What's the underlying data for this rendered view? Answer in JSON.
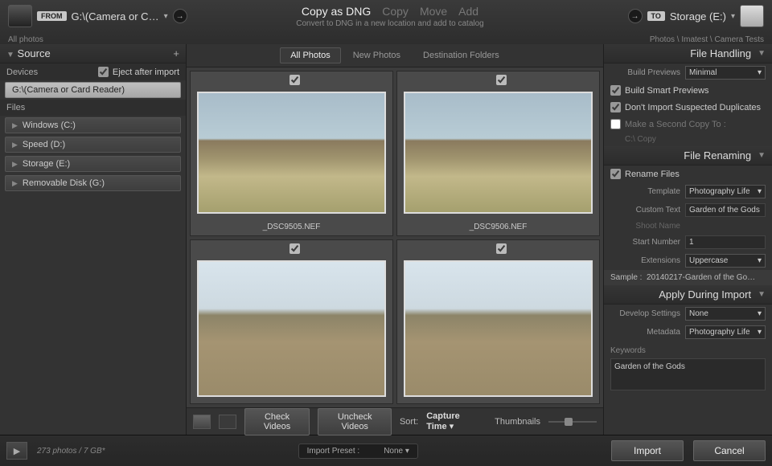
{
  "top": {
    "from_badge": "FROM",
    "from_path": "G:\\(Camera or C…",
    "from_sub": "All photos",
    "actions": {
      "copy_dng": "Copy as DNG",
      "copy": "Copy",
      "move": "Move",
      "add": "Add"
    },
    "subtitle": "Convert to DNG in a new location and add to catalog",
    "to_badge": "TO",
    "to_path": "Storage (E:)",
    "to_sub": "Photos \\ Imatest \\ Camera Tests"
  },
  "source": {
    "title": "Source",
    "devices_label": "Devices",
    "eject_label": "Eject after import",
    "selected_device": "G:\\(Camera or Card Reader)",
    "files_label": "Files",
    "drives": [
      "Windows (C:)",
      "Speed (D:)",
      "Storage (E:)",
      "Removable Disk (G:)"
    ]
  },
  "center": {
    "tabs": {
      "all": "All Photos",
      "new": "New Photos",
      "dest": "Destination Folders"
    },
    "thumbs": [
      "_DSC9505.NEF",
      "_DSC9506.NEF"
    ],
    "toolbar": {
      "check_videos": "Check Videos",
      "uncheck_videos": "Uncheck Videos",
      "sort_label": "Sort:",
      "sort_value": "Capture Time",
      "thumb_label": "Thumbnails"
    }
  },
  "right": {
    "file_handling": {
      "title": "File Handling",
      "build_previews_label": "Build Previews",
      "build_previews_value": "Minimal",
      "smart_previews": "Build Smart Previews",
      "no_dupes": "Don't Import Suspected Duplicates",
      "second_copy": "Make a Second Copy To :",
      "second_copy_path": "C:\\ Copy"
    },
    "file_renaming": {
      "title": "File Renaming",
      "rename_files": "Rename Files",
      "template_label": "Template",
      "template_value": "Photography Life",
      "custom_text_label": "Custom Text",
      "custom_text_value": "Garden of the Gods",
      "shoot_name_label": "Shoot Name",
      "start_number_label": "Start Number",
      "start_number_value": "1",
      "extensions_label": "Extensions",
      "extensions_value": "Uppercase",
      "sample_label": "Sample :",
      "sample_value": "20140217-Garden of the Go…"
    },
    "apply": {
      "title": "Apply During Import",
      "develop_label": "Develop Settings",
      "develop_value": "None",
      "metadata_label": "Metadata",
      "metadata_value": "Photography Life",
      "keywords_label": "Keywords",
      "keywords_value": "Garden of the Gods"
    }
  },
  "bottom": {
    "status": "273 photos / 7 GB*",
    "preset_label": "Import Preset :",
    "preset_value": "None",
    "import": "Import",
    "cancel": "Cancel"
  }
}
